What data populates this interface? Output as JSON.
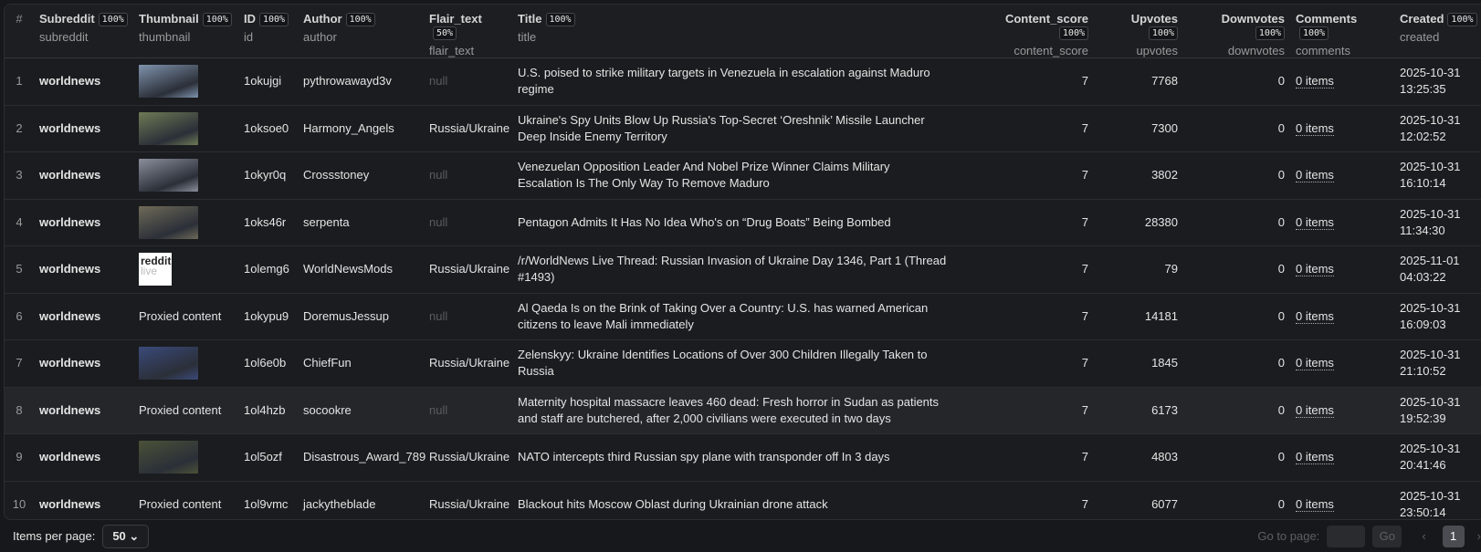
{
  "columns": [
    {
      "label": "#",
      "key": ""
    },
    {
      "label": "Subreddit",
      "pct": "100%",
      "key": "subreddit"
    },
    {
      "label": "Thumbnail",
      "pct": "100%",
      "key": "thumbnail"
    },
    {
      "label": "ID",
      "pct": "100%",
      "key": "id"
    },
    {
      "label": "Author",
      "pct": "100%",
      "key": "author"
    },
    {
      "label": "Flair_text",
      "pct": "50%",
      "key": "flair_text"
    },
    {
      "label": "Title",
      "pct": "100%",
      "key": "title"
    },
    {
      "label": "Content_score",
      "pct": "100%",
      "key": "content_score"
    },
    {
      "label": "Upvotes",
      "pct": "100%",
      "key": "upvotes"
    },
    {
      "label": "Downvotes",
      "pct": "100%",
      "key": "downvotes"
    },
    {
      "label": "Comments",
      "pct": "100%",
      "key": "comments"
    },
    {
      "label": "Created",
      "pct": "100%",
      "key": "created"
    }
  ],
  "rows": [
    {
      "n": "1",
      "subreddit": "worldnews",
      "thumb": "image",
      "id": "1okujgi",
      "author": "pythrowawayd3v",
      "flair": "null",
      "title": "U.S. poised to strike military targets in Venezuela in escalation against Maduro regime",
      "score": "7",
      "up": "7768",
      "down": "0",
      "comments": "0 items",
      "date": "2025-10-31",
      "time": "13:25:35"
    },
    {
      "n": "2",
      "subreddit": "worldnews",
      "thumb": "image",
      "id": "1oksoe0",
      "author": "Harmony_Angels",
      "flair": "Russia/Ukraine",
      "title": "Ukraine's Spy Units Blow Up Russia's Top-Secret ‘Oreshnik’ Missile Launcher Deep Inside Enemy Territory",
      "score": "7",
      "up": "7300",
      "down": "0",
      "comments": "0 items",
      "date": "2025-10-31",
      "time": "12:02:52"
    },
    {
      "n": "3",
      "subreddit": "worldnews",
      "thumb": "image",
      "id": "1okyr0q",
      "author": "Crossstoney",
      "flair": "null",
      "title": "Venezuelan Opposition Leader And Nobel Prize Winner Claims Military Escalation Is The Only Way To Remove Maduro",
      "score": "7",
      "up": "3802",
      "down": "0",
      "comments": "0 items",
      "date": "2025-10-31",
      "time": "16:10:14"
    },
    {
      "n": "4",
      "subreddit": "worldnews",
      "thumb": "image",
      "id": "1oks46r",
      "author": "serpenta",
      "flair": "null",
      "title": "Pentagon Admits It Has No Idea Who's on “Drug Boats” Being Bombed",
      "score": "7",
      "up": "28380",
      "down": "0",
      "comments": "0 items",
      "date": "2025-10-31",
      "time": "11:34:30"
    },
    {
      "n": "5",
      "subreddit": "worldnews",
      "thumb": "reddit live",
      "id": "1olemg6",
      "author": "WorldNewsMods",
      "flair": "Russia/Ukraine",
      "title": "/r/WorldNews Live Thread: Russian Invasion of Ukraine Day 1346, Part 1 (Thread #1493)",
      "score": "7",
      "up": "79",
      "down": "0",
      "comments": "0 items",
      "date": "2025-11-01",
      "time": "04:03:22"
    },
    {
      "n": "6",
      "subreddit": "worldnews",
      "thumb": "Proxied content",
      "id": "1okypu9",
      "author": "DoremusJessup",
      "flair": "null",
      "title": "Al Qaeda Is on the Brink of Taking Over a Country: U.S. has warned American citizens to leave Mali immediately",
      "score": "7",
      "up": "14181",
      "down": "0",
      "comments": "0 items",
      "date": "2025-10-31",
      "time": "16:09:03"
    },
    {
      "n": "7",
      "subreddit": "worldnews",
      "thumb": "image",
      "id": "1ol6e0b",
      "author": "ChiefFun",
      "flair": "Russia/Ukraine",
      "title": "Zelenskyy: Ukraine Identifies Locations of Over 300 Children Illegally Taken to Russia",
      "score": "7",
      "up": "1845",
      "down": "0",
      "comments": "0 items",
      "date": "2025-10-31",
      "time": "21:10:52"
    },
    {
      "n": "8",
      "subreddit": "worldnews",
      "thumb": "Proxied content",
      "id": "1ol4hzb",
      "author": "socookre",
      "flair": "null",
      "title": "Maternity hospital massacre leaves 460 dead: Fresh horror in Sudan as patients and staff are butchered, after 2,000 civilians were executed in two days",
      "score": "7",
      "up": "6173",
      "down": "0",
      "comments": "0 items",
      "date": "2025-10-31",
      "time": "19:52:39"
    },
    {
      "n": "9",
      "subreddit": "worldnews",
      "thumb": "image",
      "id": "1ol5ozf",
      "author": "Disastrous_Award_789",
      "flair": "Russia/Ukraine",
      "title": "NATO intercepts third Russian spy plane with transponder off In 3 days",
      "score": "7",
      "up": "4803",
      "down": "0",
      "comments": "0 items",
      "date": "2025-10-31",
      "time": "20:41:46"
    },
    {
      "n": "10",
      "subreddit": "worldnews",
      "thumb": "Proxied content",
      "id": "1ol9vmc",
      "author": "jackytheblade",
      "flair": "Russia/Ukraine",
      "title": "Blackout hits Moscow Oblast during Ukrainian drone attack",
      "score": "7",
      "up": "6077",
      "down": "0",
      "comments": "0 items",
      "date": "2025-10-31",
      "time": "23:50:14"
    }
  ],
  "thumb_colors": [
    "#7f93ad",
    "#6d7a55",
    "#8a8f9c",
    "#6e6a58",
    "",
    "",
    "#3a4a7a",
    "",
    "#4a5238",
    ""
  ],
  "footer": {
    "items_per_page_label": "Items per page:",
    "items_per_page": "50",
    "go_to_page": "Go to page:",
    "go": "Go",
    "prev": "‹",
    "page": "1",
    "next": "›"
  }
}
